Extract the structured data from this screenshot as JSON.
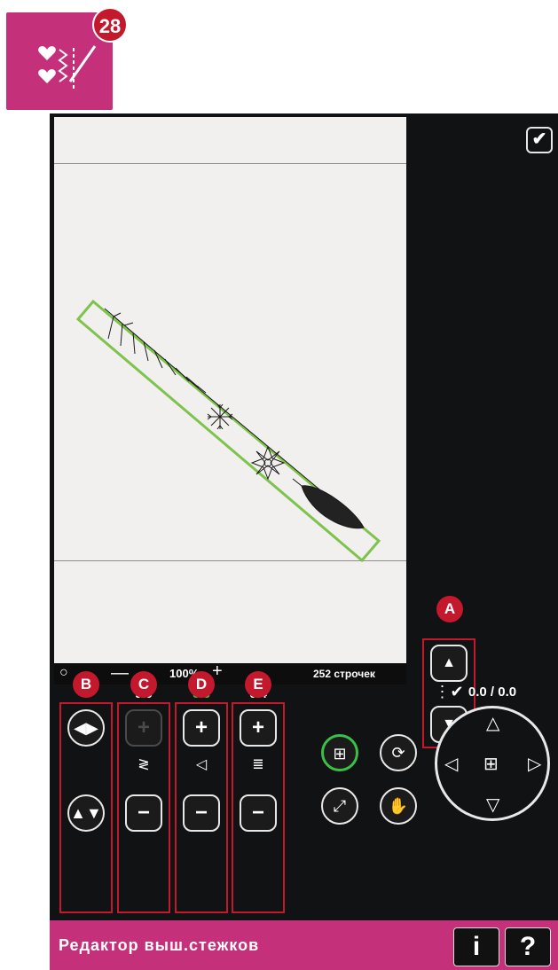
{
  "app_icon": {
    "badge": "28",
    "icon": "embroidery-stitch-editor-icon"
  },
  "canvas": {
    "confirm_icon": "checkmark"
  },
  "zoom_bar": {
    "zoom_value": "100%",
    "stitch_count": "252 строчек"
  },
  "params": [
    {
      "id": "B",
      "value": ""
    },
    {
      "id": "C",
      "value": "9.0"
    },
    {
      "id": "D",
      "value": "8.3",
      "value_color": "#49b83f"
    },
    {
      "id": "E",
      "value": "0.4"
    }
  ],
  "callouts": {
    "A": "A",
    "B": "B",
    "C": "C",
    "D": "D",
    "E": "E"
  },
  "position": {
    "coords": "0.0 / 0.0"
  },
  "bottom_bar": {
    "title": "Редактор выш.стежков",
    "info_label": "i",
    "help_label": "?"
  },
  "colors": {
    "accent": "#c4307a",
    "badge": "#c4182d",
    "screen_bg": "#111213",
    "canvas_bg": "#f1f0ef",
    "frame_green": "#7ec34b"
  }
}
